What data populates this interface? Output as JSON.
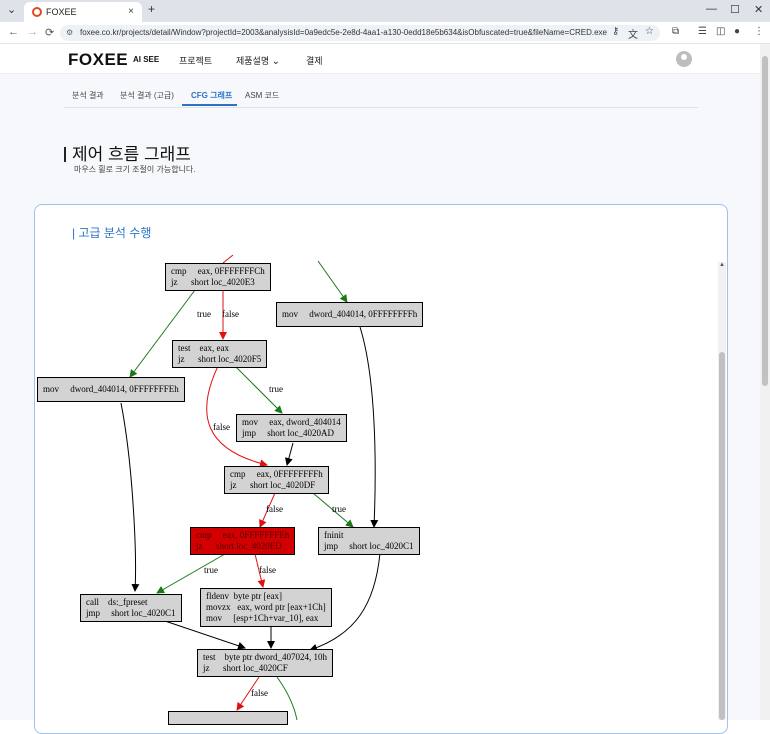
{
  "browser": {
    "tab_title": "FOXEE",
    "url": "foxee.co.kr/projects/detail/Window?projectId=2003&analysisId=0a9edc5e-2e8d-4aa1-a130-0edd18e5b634&isObfuscated=true&fileName=CRED.exe",
    "new_tab": "+",
    "close_tab": "×",
    "win_min": "—",
    "win_max": "☐",
    "win_close": "✕"
  },
  "header": {
    "logo": "FOXEE",
    "logo_sub": "AI SEE",
    "menu": [
      "프로젝트",
      "제품설명",
      "결제"
    ]
  },
  "subtabs": [
    "분석 결과",
    "분석 결과 (고급)",
    "CFG 그래프",
    "ASM 코드"
  ],
  "page": {
    "title": "제어 흐름 그래프",
    "description": "마우스 휠로 크기 조절이 가능합니다."
  },
  "card": {
    "title": "| 고급 분석 수행"
  },
  "graph": {
    "nodes": [
      {
        "id": "n1",
        "text": "cmp     eax, 0FFFFFFFCh\njz      short loc_4020E3"
      },
      {
        "id": "n2",
        "text": "mov     dword_404014, 0FFFFFFFFh"
      },
      {
        "id": "n3",
        "text": "test    eax, eax\njz      short loc_4020F5"
      },
      {
        "id": "n4",
        "text": "mov     dword_404014, 0FFFFFFFEh"
      },
      {
        "id": "n5",
        "text": "mov     eax, dword_404014\njmp     short loc_4020AD"
      },
      {
        "id": "n6",
        "text": "cmp     eax, 0FFFFFFFFh\njz      short loc_4020DF"
      },
      {
        "id": "n7",
        "text": "cmp     eax, 0FFFFFFFEh\njz      short loc_4020ED"
      },
      {
        "id": "n8",
        "text": "fninit\njmp     short loc_4020C1"
      },
      {
        "id": "n9",
        "text": "call    ds:_fpreset\njmp     short loc_4020C1"
      },
      {
        "id": "n10",
        "text": "fldenv  byte ptr [eax]\nmovzx   eax, word ptr [eax+1Ch]\nmov     [esp+1Ch+var_10], eax"
      },
      {
        "id": "n11",
        "text": "test    byte ptr dword_407024, 10h\njz      short loc_4020CF"
      },
      {
        "id": "n12",
        "text": ""
      }
    ],
    "edge_labels": {
      "n1_true": "true",
      "n1_false": "false",
      "n3_true": "true",
      "n3_false": "false",
      "n6_false": "false",
      "n6_true": "true",
      "n7_true": "true",
      "n7_false": "false",
      "n11_false": "false"
    },
    "colors": {
      "true_edge": "#1a7a1a",
      "false_edge": "#e01010",
      "plain_edge": "#000000",
      "highlight_node": "#d20000",
      "node_fill": "#d3d3d3"
    }
  },
  "icons": {
    "back": "←",
    "forward": "→",
    "reload": "⟳",
    "tab_list": "⌄",
    "site_info": "⚙",
    "key": "⚷",
    "translate": "文",
    "star": "☆",
    "extensions": "⧉",
    "media": "☰",
    "sidebar": "◫",
    "profile": "●",
    "more": "⋮",
    "chevron": "⌄",
    "scroll_up": "▲"
  }
}
